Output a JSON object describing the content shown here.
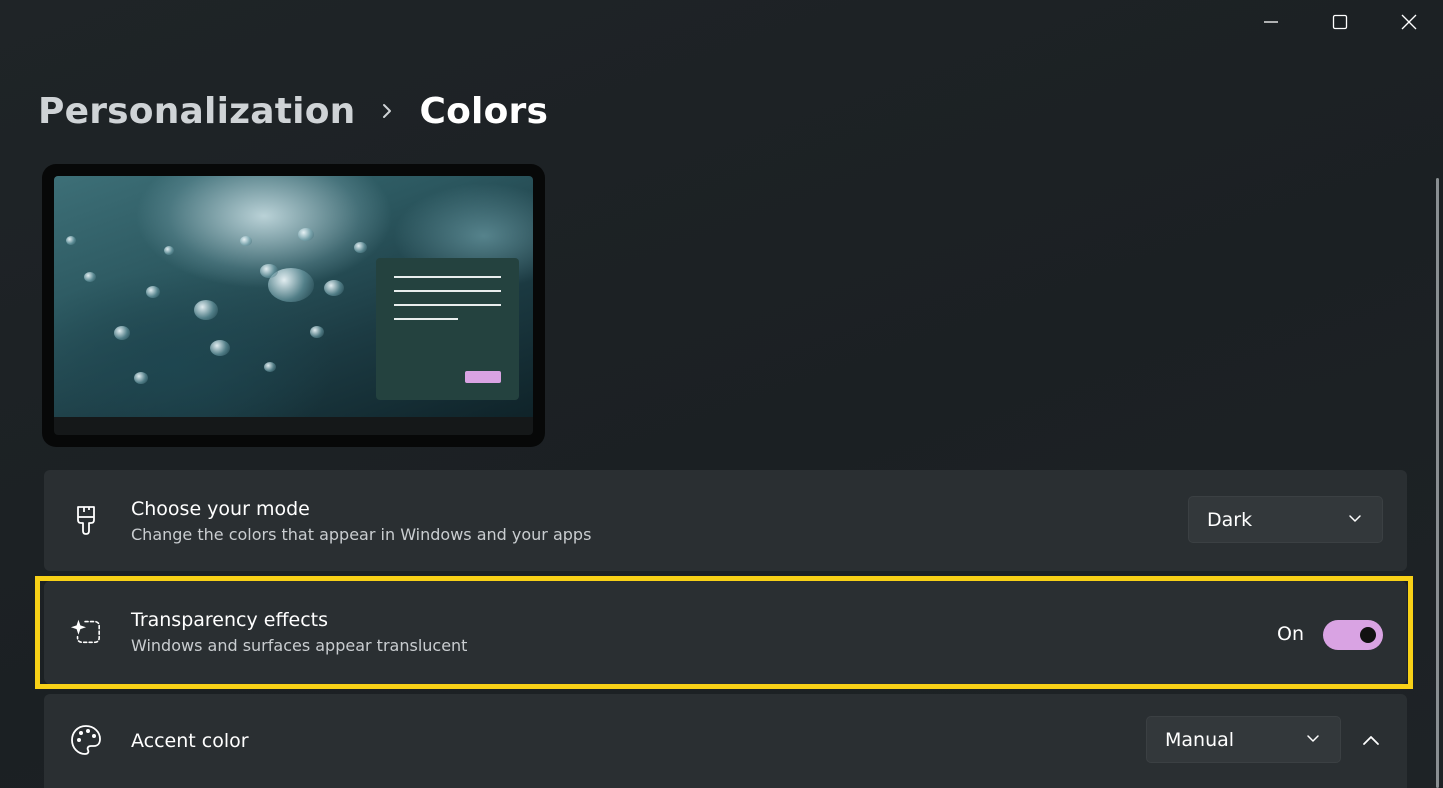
{
  "window": {
    "caption": {
      "minimize_icon": "minimize-icon",
      "maximize_icon": "maximize-icon",
      "close_icon": "close-icon"
    }
  },
  "breadcrumb": {
    "parent": "Personalization",
    "separator_icon": "chevron-right-icon",
    "current": "Colors"
  },
  "preview": {
    "window_button_color": "#d9a3e3",
    "window_color": "#24423f"
  },
  "settings": {
    "mode": {
      "icon": "paintbrush-icon",
      "title": "Choose your mode",
      "subtitle": "Change the colors that appear in Windows and your apps",
      "selected": "Dark"
    },
    "transparency": {
      "icon": "transparency-icon",
      "title": "Transparency effects",
      "subtitle": "Windows and surfaces appear translucent",
      "state_label": "On",
      "enabled": true
    },
    "accent": {
      "icon": "palette-icon",
      "title": "Accent color",
      "selected": "Manual",
      "expanded": true
    }
  },
  "colors": {
    "accent": "#d9a3e3",
    "highlight": "#f8d117",
    "background": "#1d2225",
    "card": "#2a2f32"
  }
}
